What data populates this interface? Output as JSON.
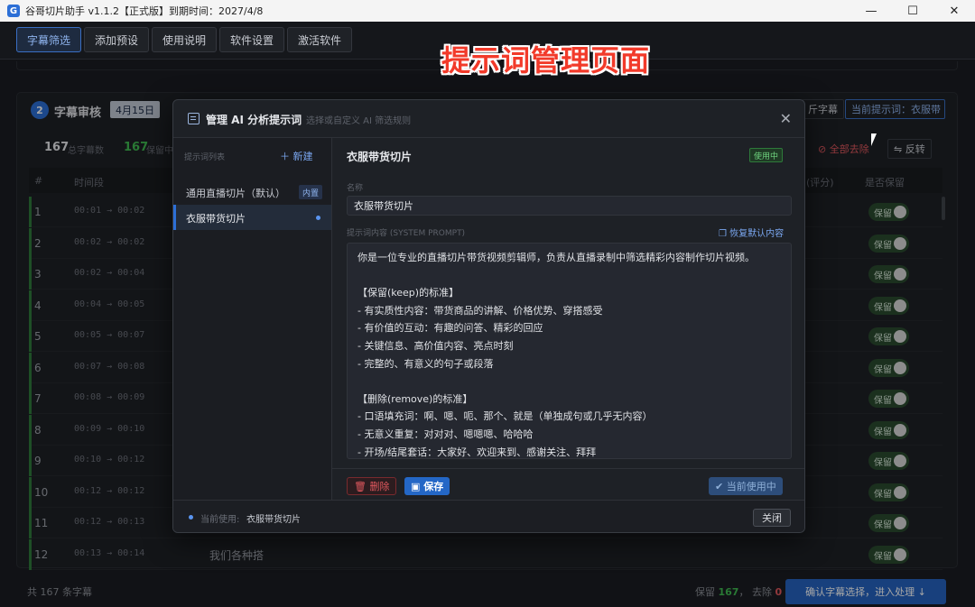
{
  "window": {
    "title": "谷哥切片助手 v1.1.2【正式版】到期时间：2027/4/8",
    "minimize_icon": "—",
    "maximize_icon": "☐",
    "close_icon": "✕"
  },
  "nav": {
    "tabs": [
      {
        "label": "字幕筛选",
        "active": true
      },
      {
        "label": "添加预设",
        "active": false
      },
      {
        "label": "使用说明",
        "active": false
      },
      {
        "label": "软件设置",
        "active": false
      },
      {
        "label": "激活软件",
        "active": false
      }
    ]
  },
  "caption": "提示词管理页面",
  "step": {
    "number": "2",
    "title": "字幕审核",
    "date": "4月15日",
    "total_count": "167",
    "total_label": "总字幕数",
    "keep_count": "167",
    "keep_label": "保留中",
    "btn_subtitle": "斤字幕",
    "current_prompt": "当前提示词：衣服带",
    "remove_all": "全部去除",
    "invert": "反转",
    "columns": {
      "index": "#",
      "time": "时间段",
      "score": "(评分)",
      "keep": "是否保留"
    }
  },
  "rows": [
    {
      "n": "1",
      "time": "00:01 → 00:02",
      "text": "",
      "keep": "保留"
    },
    {
      "n": "2",
      "time": "00:02 → 00:02",
      "text": "",
      "keep": "保留"
    },
    {
      "n": "3",
      "time": "00:02 → 00:04",
      "text": "",
      "keep": "保留"
    },
    {
      "n": "4",
      "time": "00:04 → 00:05",
      "text": "",
      "keep": "保留"
    },
    {
      "n": "5",
      "time": "00:05 → 00:07",
      "text": "",
      "keep": "保留"
    },
    {
      "n": "6",
      "time": "00:07 → 00:08",
      "text": "",
      "keep": "保留"
    },
    {
      "n": "7",
      "time": "00:08 → 00:09",
      "text": "",
      "keep": "保留"
    },
    {
      "n": "8",
      "time": "00:09 → 00:10",
      "text": "",
      "keep": "保留"
    },
    {
      "n": "9",
      "time": "00:10 → 00:12",
      "text": "",
      "keep": "保留"
    },
    {
      "n": "10",
      "time": "00:12 → 00:12",
      "text": "",
      "keep": "保留"
    },
    {
      "n": "11",
      "time": "00:12 → 00:13",
      "text": "",
      "keep": "保留"
    },
    {
      "n": "12",
      "time": "00:13 → 00:14",
      "text": "我们各种搭",
      "keep": "保留"
    }
  ],
  "footer": {
    "count": "共 167 条字幕",
    "keep_label": "保留",
    "keep_value": "167",
    "remove_label": "去除",
    "remove_value": "0",
    "confirm": "确认字幕选择，进入处理 ↓"
  },
  "modal": {
    "title": "管理 AI 分析提示词",
    "subtitle": "选择或自定义 AI 筛选规则",
    "close_icon": "✕",
    "list_header": "提示词列表",
    "new_label": "＋ 新建",
    "items": [
      {
        "label": "通用直播切片（默认）",
        "badge": "内置"
      },
      {
        "label": "衣服带货切片",
        "badge": ""
      }
    ],
    "detail": {
      "title": "衣服带货切片",
      "status": "使用中",
      "name_label": "名称",
      "name_value": "衣服带货切片",
      "prompt_label": "提示词内容 (SYSTEM PROMPT)",
      "restore": "恢复默认内容",
      "prompt_text": "你是一位专业的直播切片带货视频剪辑师，负责从直播录制中筛选精彩内容制作切片视频。\n\n【保留(keep)的标准】\n- 有实质性内容：带货商品的讲解、价格优势、穿搭感受\n- 有价值的互动：有趣的问答、精彩的回应\n- 关键信息、高价值内容、亮点时刻\n- 完整的、有意义的句子或段落\n\n【删除(remove)的标准】\n- 口语填充词：啊、嗯、呃、那个、就是（单独成句或几乎无内容）\n- 无意义重复：对对对、嗯嗯嗯、哈哈哈\n- 开场/结尾套话：大家好、欢迎来到、感谢关注、拜拜",
      "delete": "删除",
      "save": "保存",
      "current": "当前使用中"
    },
    "footer": {
      "current_label": "当前使用:",
      "current_value": "衣服带货切片",
      "close": "关闭"
    }
  },
  "colors": {
    "accent": "#2c6fd6",
    "keep_green": "#3fb950",
    "danger": "#e0585e",
    "caption_red": "#f23a2a"
  }
}
